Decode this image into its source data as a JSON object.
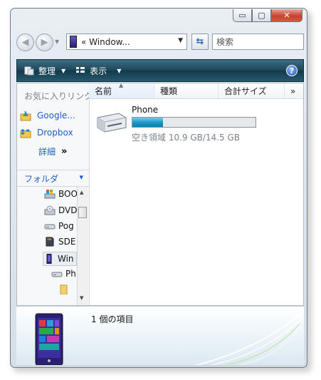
{
  "window": {
    "caption_min": "▭",
    "caption_max": "▢",
    "caption_close": "✕"
  },
  "nav": {
    "back_glyph": "◀",
    "forward_glyph": "▶",
    "address_text": "«  Window...",
    "search_placeholder": "検索"
  },
  "toolbar": {
    "organize_label": "整理",
    "views_label": "表示",
    "help_glyph": "?"
  },
  "favorites": {
    "header": "お気に入りリンク",
    "items": [
      {
        "label": "Google...",
        "icon": "google-drive-icon"
      },
      {
        "label": "Dropbox",
        "icon": "dropbox-icon"
      }
    ],
    "more_label": "詳細",
    "more_glyph": "»"
  },
  "folders": {
    "header": "フォルダ",
    "chevron": "⌄",
    "items": [
      {
        "label": "BOO",
        "icon": "windows-computer-icon"
      },
      {
        "label": "DVD",
        "icon": "dvd-drive-icon"
      },
      {
        "label": "Pog",
        "icon": "drive-icon"
      },
      {
        "label": "SDE",
        "icon": "sd-card-icon"
      },
      {
        "label": "Win",
        "icon": "phone-icon"
      },
      {
        "label": "Ph",
        "icon": "drive-icon"
      },
      {
        "label": "",
        "icon": "folder-icon"
      }
    ]
  },
  "columns": [
    {
      "label": "名前"
    },
    {
      "label": "種類"
    },
    {
      "label": "合計サイズ"
    }
  ],
  "columns_more": "»",
  "drive": {
    "name": "Phone",
    "usage_fraction": 0.25,
    "free_text": "空き領域 10.9 GB/14.5 GB"
  },
  "details": {
    "item_count": "1 個の項目"
  },
  "colors": {
    "toolbar": "#1c4658",
    "link": "#2160c4",
    "progress": "#1596c6"
  }
}
